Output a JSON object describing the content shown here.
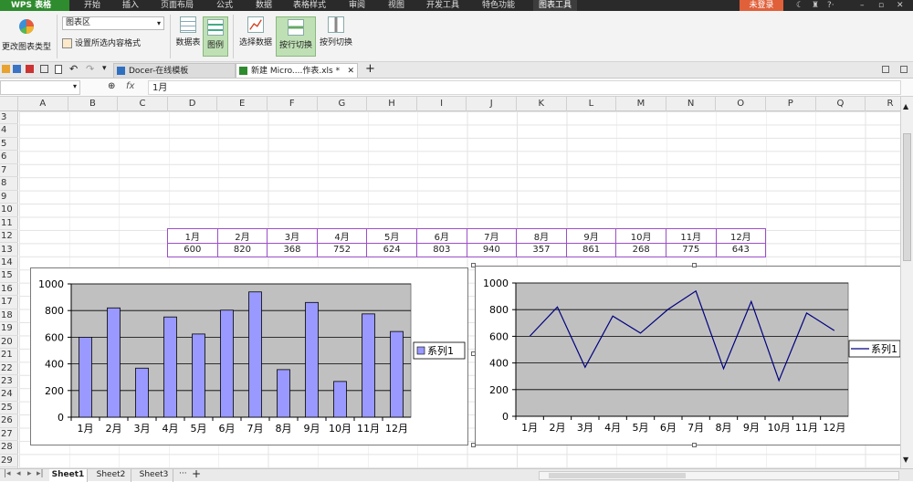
{
  "menubar": {
    "app_name": "WPS 表格",
    "items": [
      "开始",
      "插入",
      "页面布局",
      "公式",
      "数据",
      "表格样式",
      "审阅",
      "视图",
      "开发工具",
      "特色功能",
      "图表工具"
    ],
    "login": "未登录"
  },
  "ribbon": {
    "change_chart_type": "更改图表类型",
    "chart_area_select": "图表区",
    "format_selection": "设置所选内容格式",
    "data_table": "数据表",
    "legend": "图例",
    "select_data": "选择数据",
    "switch_row": "按行切换",
    "switch_col": "按列切换"
  },
  "doctabs": {
    "tab1": "Docer-在线模板",
    "tab2": "新建 Micro....作表.xls *"
  },
  "formula": {
    "fx_label": "fx",
    "content": "1月"
  },
  "columns": [
    "A",
    "B",
    "C",
    "D",
    "E",
    "F",
    "G",
    "H",
    "I",
    "J",
    "K",
    "L",
    "M",
    "N",
    "O",
    "P",
    "Q",
    "R"
  ],
  "rows": [
    "3",
    "4",
    "5",
    "6",
    "7",
    "8",
    "9",
    "10",
    "11",
    "12",
    "13",
    "14",
    "15",
    "16",
    "17",
    "18",
    "19",
    "20",
    "21",
    "22",
    "23",
    "24",
    "25",
    "26",
    "27",
    "28",
    "29"
  ],
  "table": {
    "months": [
      "1月",
      "2月",
      "3月",
      "4月",
      "5月",
      "6月",
      "7月",
      "8月",
      "9月",
      "10月",
      "11月",
      "12月"
    ],
    "values": [
      "600",
      "820",
      "368",
      "752",
      "624",
      "803",
      "940",
      "357",
      "861",
      "268",
      "775",
      "643"
    ]
  },
  "sheets": [
    "Sheet1",
    "Sheet2",
    "Sheet3"
  ],
  "chart_data": [
    {
      "type": "bar",
      "categories": [
        "1月",
        "2月",
        "3月",
        "4月",
        "5月",
        "6月",
        "7月",
        "8月",
        "9月",
        "10月",
        "11月",
        "12月"
      ],
      "series": [
        {
          "name": "系列1",
          "values": [
            600,
            820,
            368,
            752,
            624,
            803,
            940,
            357,
            861,
            268,
            775,
            643
          ],
          "color": "#9999ff"
        }
      ],
      "ylim": [
        0,
        1000
      ],
      "yticks": [
        "0",
        "200",
        "400",
        "600",
        "800",
        "1000"
      ],
      "grid": true,
      "legend": "right",
      "plot_bg": "#c0c0c0"
    },
    {
      "type": "line",
      "categories": [
        "1月",
        "2月",
        "3月",
        "4月",
        "5月",
        "6月",
        "7月",
        "8月",
        "9月",
        "10月",
        "11月",
        "12月"
      ],
      "series": [
        {
          "name": "系列1",
          "values": [
            600,
            820,
            368,
            752,
            624,
            803,
            940,
            357,
            861,
            268,
            775,
            643
          ],
          "color": "#000080"
        }
      ],
      "ylim": [
        0,
        1000
      ],
      "yticks": [
        "0",
        "200",
        "400",
        "600",
        "800",
        "1000"
      ],
      "grid": true,
      "legend": "right",
      "plot_bg": "#c0c0c0"
    }
  ]
}
